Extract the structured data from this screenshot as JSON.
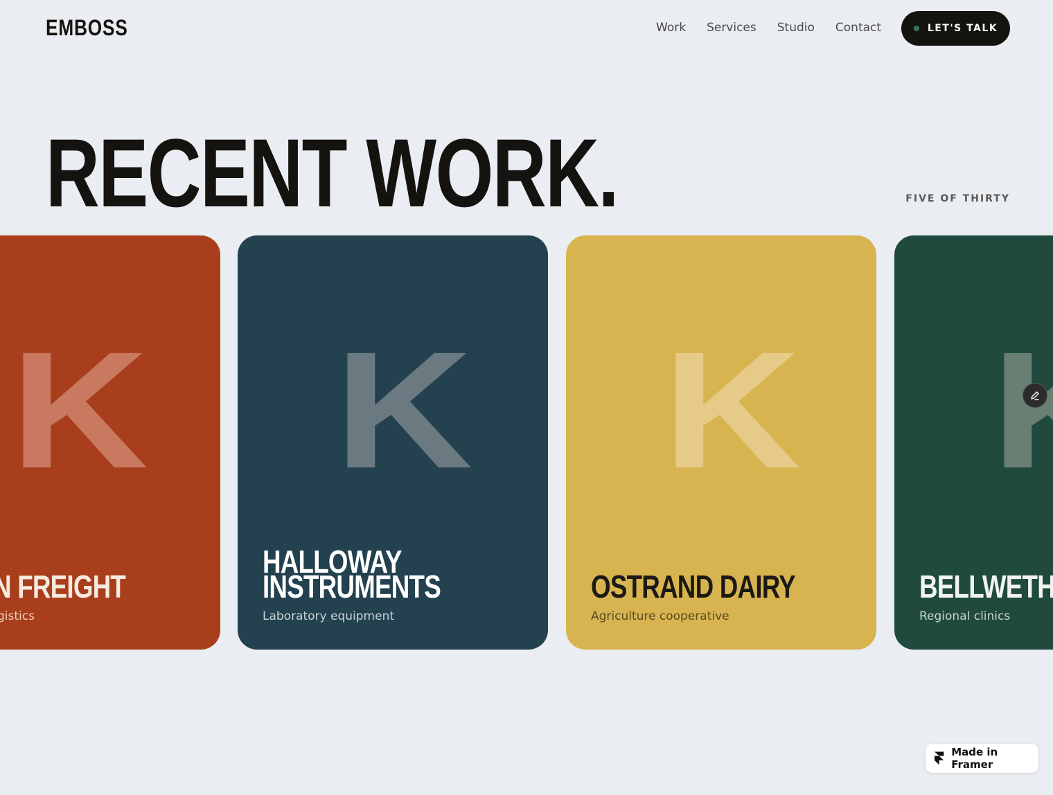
{
  "brand": {
    "name": "EMBOSS"
  },
  "nav": {
    "items": [
      {
        "label": "Work"
      },
      {
        "label": "Services"
      },
      {
        "label": "Studio"
      },
      {
        "label": "Contact"
      }
    ],
    "cta_label": "LET'S TALK"
  },
  "hero": {
    "title": "RECENT WORK.",
    "counter": "FIVE OF THIRTY"
  },
  "cards": [
    {
      "name": "N FREIGHT",
      "subtitle": "gistics",
      "letter": "K",
      "bg": "#a83e1b",
      "letter_color": "#c87960",
      "name_color": "#f6eadf",
      "sub_color": "#f1cdbd"
    },
    {
      "name": "HALLOWAY\nINSTRUMENTS",
      "subtitle": "Laboratory equipment",
      "letter": "K",
      "bg": "#23414f",
      "letter_color": "#6b7a80",
      "name_color": "#ffffff",
      "sub_color": "#c9d3d7"
    },
    {
      "name": "OSTRAND DAIRY",
      "subtitle": "Agriculture cooperative",
      "letter": "K",
      "bg": "#d8b451",
      "letter_color": "#e6ca87",
      "name_color": "#1b1a14",
      "sub_color": "#5a4b1f"
    },
    {
      "name": "BELLWETHER",
      "subtitle": "Regional clinics",
      "letter": "K",
      "bg": "#1f4a3d",
      "letter_color": "#6a7f74",
      "name_color": "#f2f4ef",
      "sub_color": "#c9d6cf"
    }
  ],
  "badge": {
    "label": "Made in Framer"
  },
  "icons": {
    "edit": "pencil-icon",
    "framer": "framer-logo-icon",
    "cta_dot": "status-dot-icon"
  }
}
